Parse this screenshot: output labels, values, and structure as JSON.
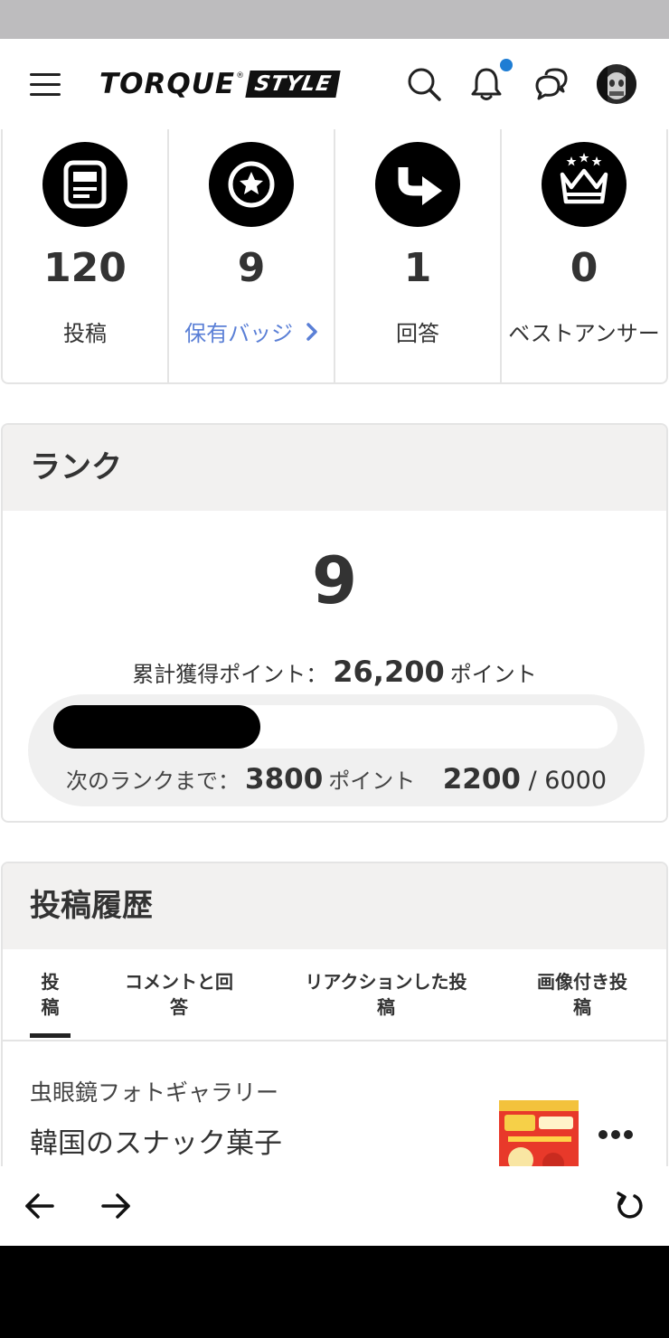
{
  "header": {
    "logo_main": "TORQUE",
    "logo_reg": "®",
    "logo_style": "STYLE",
    "icons": [
      "menu-icon",
      "search-icon",
      "bell-icon",
      "chat-icon",
      "avatar"
    ]
  },
  "stats": [
    {
      "icon": "article-icon",
      "value": "120",
      "label": "投稿"
    },
    {
      "icon": "star-badge-icon",
      "value": "9",
      "label": "保有バッジ",
      "link": true
    },
    {
      "icon": "reply-arrow-icon",
      "value": "1",
      "label": "回答"
    },
    {
      "icon": "crown-icon",
      "value": "0",
      "label": "ベストアンサー"
    }
  ],
  "rank": {
    "heading": "ランク",
    "level": "9",
    "total_label": "累計獲得ポイント：",
    "total_value": "26,200",
    "total_unit": "ポイント",
    "next_label": "次のランクまで：",
    "next_value": "3800",
    "next_unit": "ポイント",
    "current": "2200",
    "separator": "/",
    "target": "6000",
    "progress_fraction": 0.3667
  },
  "posts": {
    "heading": "投稿履歴",
    "tabs": [
      {
        "line1": "投",
        "line2": "稿",
        "active": true
      },
      {
        "line1": "コメントと回",
        "line2": "答"
      },
      {
        "line1": "リアクションした投",
        "line2": "稿"
      },
      {
        "line1": "画像付き投",
        "line2": "稿"
      }
    ],
    "items": [
      {
        "category": "虫眼鏡フォトギャラリー",
        "title": "韓国のスナック菓子",
        "more": "•••"
      }
    ]
  },
  "browser": {
    "icons": [
      "back-arrow-icon",
      "forward-arrow-icon",
      "reload-icon"
    ]
  },
  "colors": {
    "link": "#5a7fd6",
    "notification_dot": "#1e7dd4",
    "section_header_bg": "#f2f1f0"
  }
}
